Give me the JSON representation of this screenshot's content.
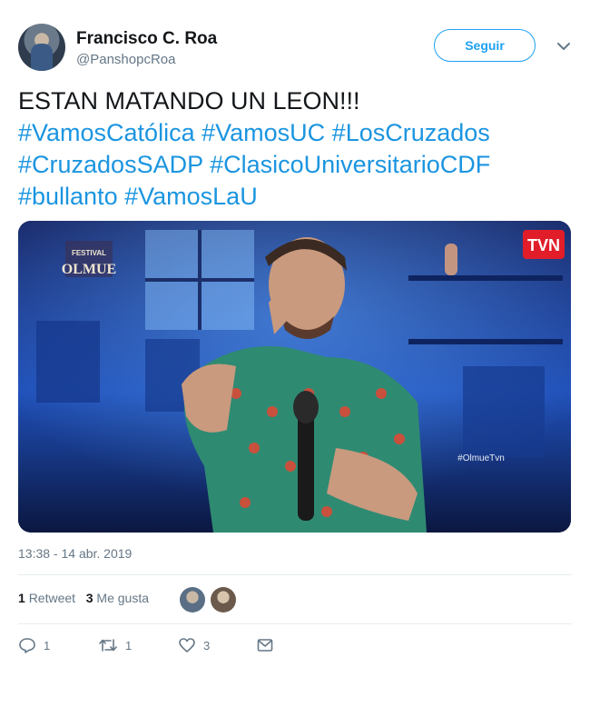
{
  "author": {
    "name": "Francisco C. Roa",
    "handle": "@PanshopcRoa"
  },
  "follow_button": {
    "label": "Seguir"
  },
  "tweet": {
    "text": "ESTAN MATANDO UN LEON!!!",
    "hashtags": [
      "#VamosCatólica",
      "#VamosUC",
      "#LosCruzados",
      "#CruzadosSADP",
      "#ClasicoUniversitarioCDF",
      "#bullanto",
      "#VamosLaU"
    ]
  },
  "media": {
    "logo_text_top": "FESTIVAL",
    "logo_text_main": "OLMUE",
    "channel_badge": "TVN",
    "watermark": "#OlmueTvn"
  },
  "timestamp": "13:38 - 14 abr. 2019",
  "stats": {
    "retweets_count": "1",
    "retweets_label": "Retweet",
    "likes_count": "3",
    "likes_label": "Me gusta"
  },
  "actions": {
    "reply_count": "1",
    "retweet_count": "1",
    "like_count": "3"
  },
  "colors": {
    "accent": "#1da1f2",
    "link": "#1b95e0",
    "muted": "#657786"
  }
}
